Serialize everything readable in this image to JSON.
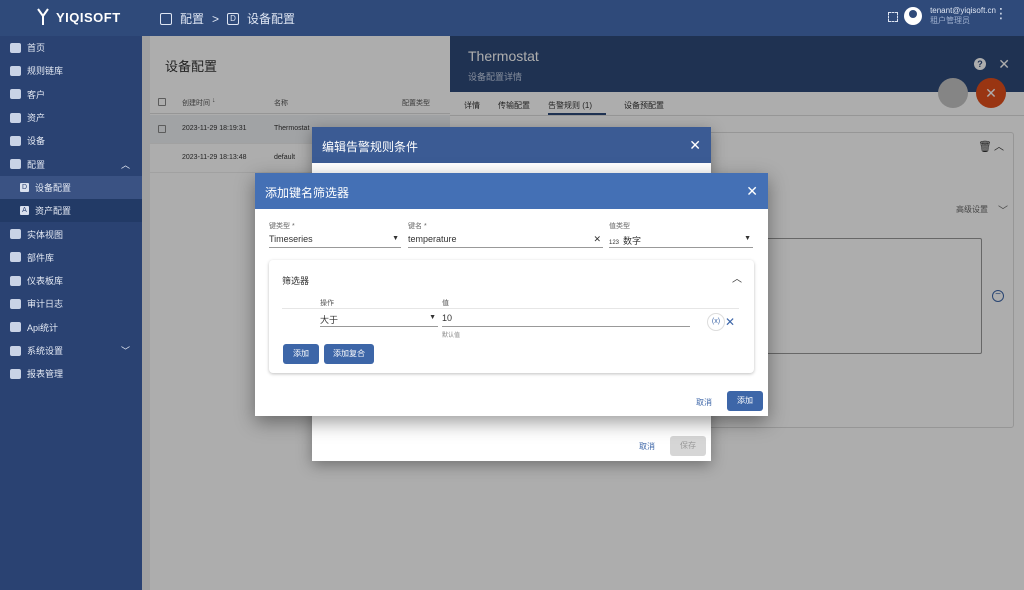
{
  "brand": "YIQISOFT",
  "breadcrumb": {
    "item1": "配置",
    "sep": ">",
    "item2": "设备配置"
  },
  "user": {
    "email": "tenant@yiqisoft.cn",
    "role": "租户管理员"
  },
  "sidebar": {
    "items": [
      {
        "label": "首页"
      },
      {
        "label": "规则链库"
      },
      {
        "label": "客户"
      },
      {
        "label": "资产"
      },
      {
        "label": "设备"
      },
      {
        "label": "配置"
      },
      {
        "label": "设备配置"
      },
      {
        "label": "资产配置"
      },
      {
        "label": "实体视图"
      },
      {
        "label": "部件库"
      },
      {
        "label": "仪表板库"
      },
      {
        "label": "审计日志"
      },
      {
        "label": "Api统计"
      },
      {
        "label": "系统设置"
      },
      {
        "label": "报表管理"
      }
    ]
  },
  "page": {
    "title": "设备配置",
    "columns": {
      "created": "创建时间",
      "name": "名称",
      "type": "配置类型"
    },
    "rows": [
      {
        "created": "2023-11-29 18:19:31",
        "name": "Thermostat"
      },
      {
        "created": "2023-11-29 18:13:48",
        "name": "default"
      }
    ]
  },
  "panel": {
    "title": "Thermostat",
    "subtitle": "设备配置详情",
    "tabs": [
      "详情",
      "传输配置",
      "告警规则 (1)",
      "设备预配置"
    ],
    "advanced": "高级设置"
  },
  "dialog1": {
    "title": "编辑告警规则条件",
    "cancel": "取消",
    "save": "保存"
  },
  "dialog2": {
    "title": "添加键名筛选器",
    "key_type_label": "键类型 *",
    "key_type_value": "Timeseries",
    "key_name_label": "键名 *",
    "key_name_value": "temperature",
    "value_type_label": "值类型",
    "value_type_value": "数字",
    "value_type_icon": "123",
    "filter_title": "筛选器",
    "op_label": "操作",
    "val_label": "值",
    "op_value": "大于",
    "val_value": "10",
    "default_hint": "默认值",
    "fx": "(x)",
    "add": "添加",
    "add_complex": "添加复合",
    "cancel": "取消",
    "confirm": "添加"
  }
}
